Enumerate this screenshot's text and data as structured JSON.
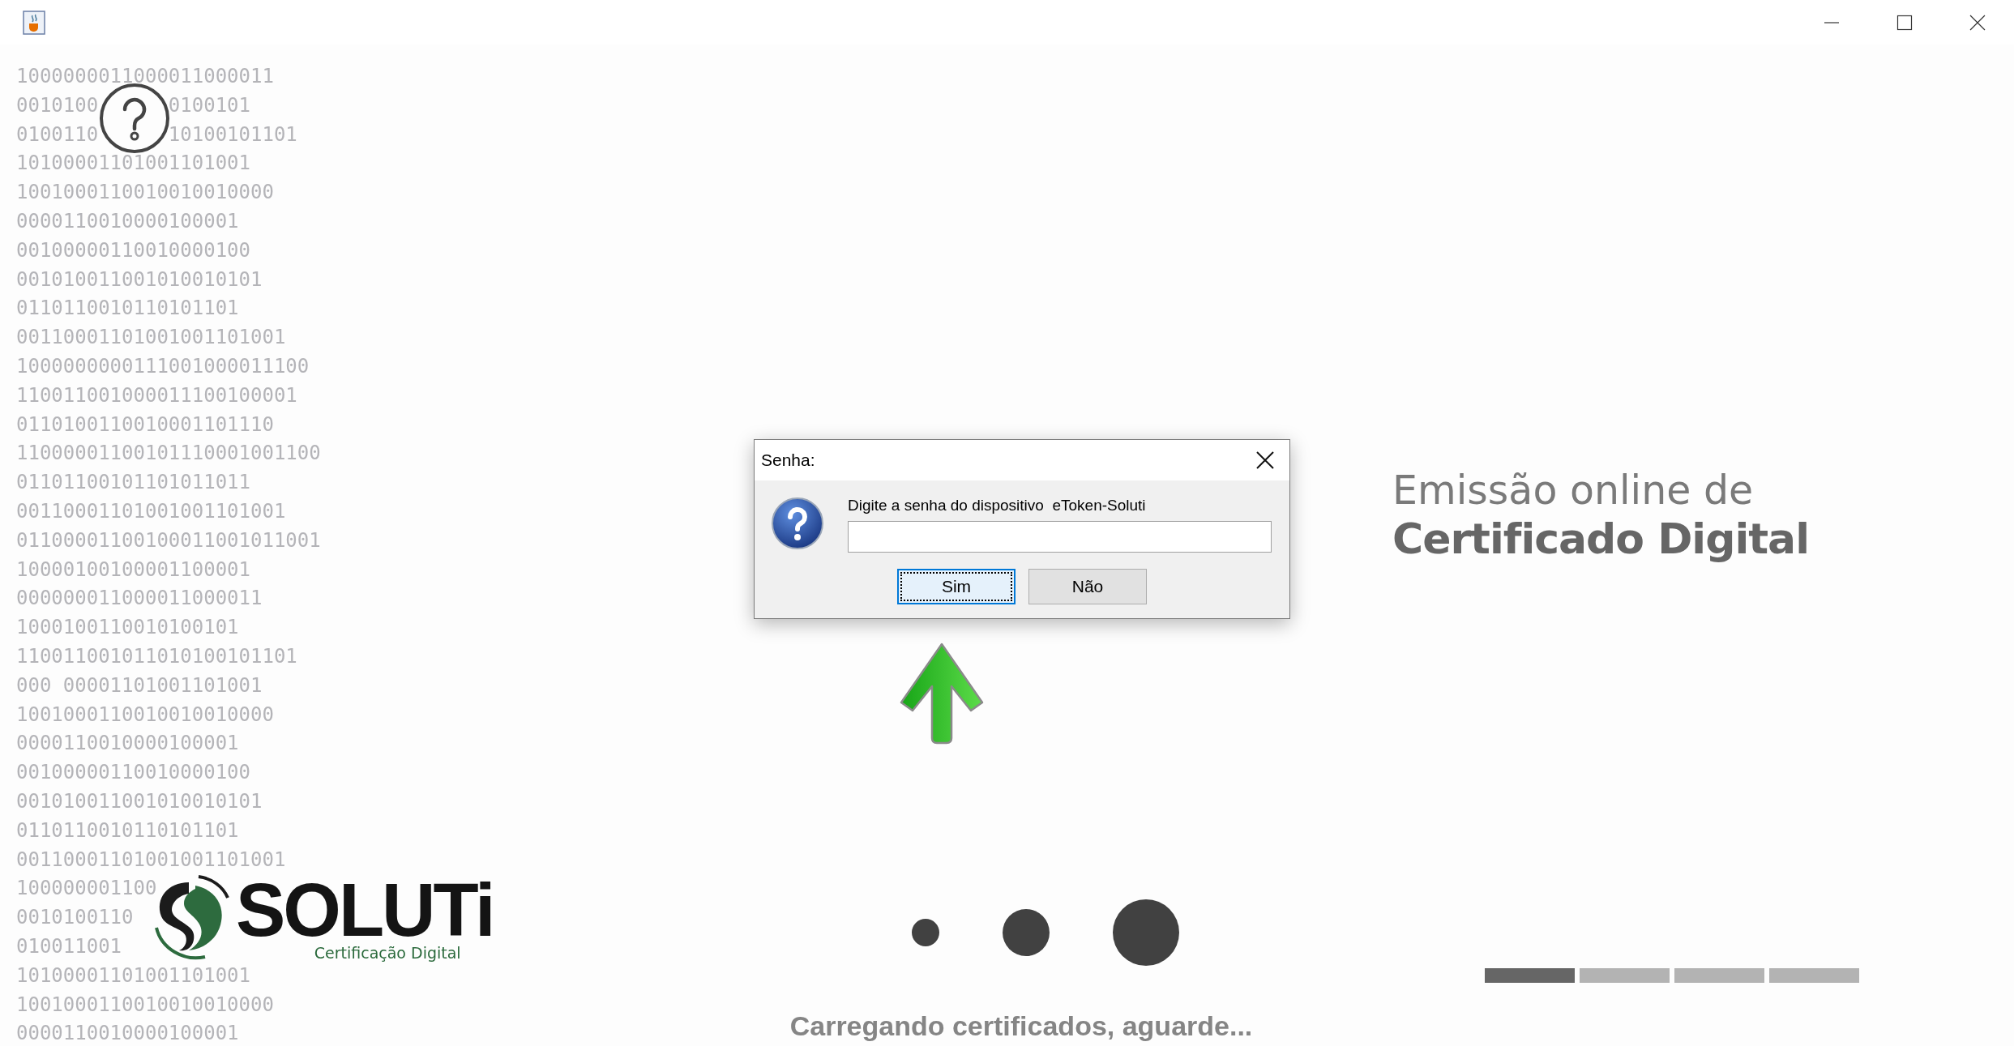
{
  "background_code": [
    "1000000011000011000011",
    [
      "0010100",
      "0100101"
    ],
    [
      "0100110",
      "10100101101"
    ],
    "10100001101001101001",
    "1001000110010010010000",
    "0000110010000100001",
    "00100000110010000100",
    "001010011001010010101",
    "0110110010110101101",
    "00110001101001001101001",
    "1000000000111001000011100",
    "110011001000011100100001",
    "0110100110010001101110",
    "11000001100101110001001100",
    "01101100101101011011",
    "00110001101001001101001",
    "01100001100100011001011001",
    "10000100100001100001",
    "000000011000011000011",
    "1000100110010100101",
    "110011001011010100101101",
    "000 00001101001101001",
    "1001000110010010010000",
    "0000110010000100001",
    "00100000110010000100",
    "001010011001010010101",
    "0110110010110101101",
    "00110001101001001101001",
    "100000001100",
    "0010100110",
    "010011001",
    "10100001101001101001",
    "1001000110010010010000",
    "0000110010000100001"
  ],
  "logo": {
    "name": "SOLUTi",
    "tagline": "Certificação Digital"
  },
  "dialog": {
    "title": "Senha:",
    "message": "Digite a senha do dispositivo  eToken-Soluti",
    "buttons": [
      {
        "label": "Sim",
        "focused": true
      },
      {
        "label": "Não",
        "focused": false
      }
    ]
  },
  "loading": {
    "text": "Carregando certificados, aguarde..."
  },
  "heading": {
    "line_1": "Emissão online de",
    "line_2": "Certificado Digital"
  },
  "progress_steps": [
    {
      "active": true
    },
    {
      "active": false
    },
    {
      "active": false
    },
    {
      "active": false
    }
  ]
}
